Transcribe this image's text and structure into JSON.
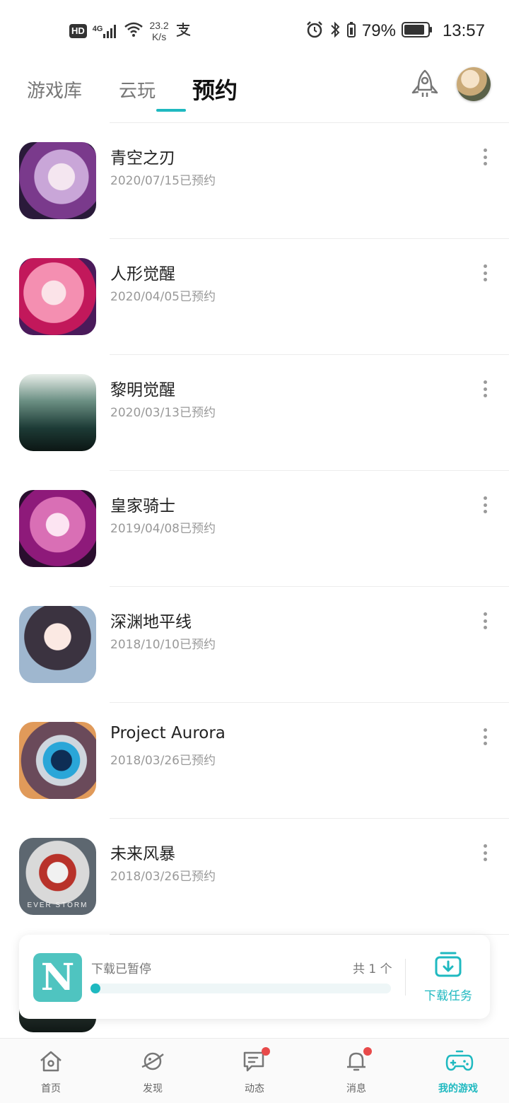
{
  "status_bar": {
    "hd": "HD",
    "network_type": "4G",
    "speed_value": "23.2",
    "speed_unit": "K/s",
    "battery_percent": "79%",
    "time": "13:57"
  },
  "tabs": [
    {
      "label": "游戏库",
      "active": false
    },
    {
      "label": "云玩",
      "active": false
    },
    {
      "label": "预约",
      "active": true
    }
  ],
  "games": [
    {
      "name": "青空之刃",
      "date": "2020/07/15已预约"
    },
    {
      "name": "人形觉醒",
      "date": "2020/04/05已预约"
    },
    {
      "name": "黎明觉醒",
      "date": "2020/03/13已预约"
    },
    {
      "name": "皇家骑士",
      "date": "2019/04/08已预约"
    },
    {
      "name": "深渊地平线",
      "date": "2018/10/10已预约"
    },
    {
      "name": "Project Aurora",
      "date": "2018/03/26已预约"
    },
    {
      "name": "未来风暴",
      "date": "2018/03/26已预约",
      "thumb_caption": "EVER STORM"
    }
  ],
  "download": {
    "logo_letter": "N",
    "status": "下载已暂停",
    "count": "共 1 个",
    "progress": 0.0,
    "task_label": "下载任务"
  },
  "bottom_nav": [
    {
      "label": "首页",
      "icon": "home-icon",
      "badge": false
    },
    {
      "label": "发现",
      "icon": "planet-icon",
      "badge": false
    },
    {
      "label": "动态",
      "icon": "chat-icon",
      "badge": true
    },
    {
      "label": "消息",
      "icon": "bell-icon",
      "badge": true
    },
    {
      "label": "我的游戏",
      "icon": "gamepad-icon",
      "badge": false,
      "active": true
    }
  ],
  "colors": {
    "accent": "#1fb9c0",
    "badge": "#e84a4a"
  }
}
